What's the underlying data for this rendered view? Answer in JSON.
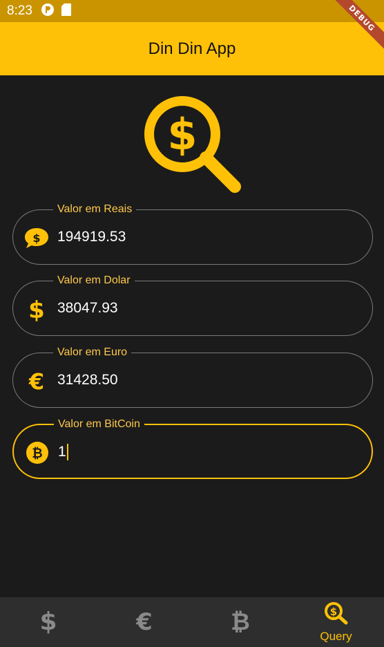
{
  "status_bar": {
    "time": "8:23"
  },
  "debug_banner": "DEBUG",
  "app_bar": {
    "title": "Din Din App"
  },
  "colors": {
    "accent": "#ffc107",
    "background": "#1b1b1b",
    "nav_background": "#2e2e2e"
  },
  "fields": [
    {
      "label": "Valor em Reais",
      "value": "194919.53",
      "icon": "real-chat-bubble-icon"
    },
    {
      "label": "Valor em Dolar",
      "value": "38047.93",
      "icon": "dollar-icon"
    },
    {
      "label": "Valor em Euro",
      "value": "31428.50",
      "icon": "euro-icon"
    },
    {
      "label": "Valor em BitCoin",
      "value": "1",
      "icon": "bitcoin-icon",
      "focused": true
    }
  ],
  "bottom_nav": {
    "items": [
      {
        "icon": "dollar-icon",
        "label": ""
      },
      {
        "icon": "euro-icon",
        "label": ""
      },
      {
        "icon": "bitcoin-icon",
        "label": ""
      },
      {
        "icon": "search-dollar-icon",
        "label": "Query",
        "active": true
      }
    ]
  }
}
